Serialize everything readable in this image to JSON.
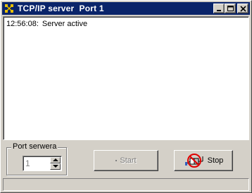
{
  "window": {
    "title": "TCP/IP server  Port 1"
  },
  "log": {
    "lines": [
      {
        "time": "12:56:08:",
        "message": "Server active"
      }
    ]
  },
  "port_group": {
    "label": "Port serwera",
    "value": "1"
  },
  "buttons": {
    "start_label": "Start",
    "stop_label": "Stop"
  },
  "colors": {
    "titlebar": "#0a246a",
    "face": "#d4d0c8",
    "stop_icon_ring": "#e00000"
  },
  "icons": {
    "app": "server-network-icon",
    "stop": "no-connection-icon"
  }
}
